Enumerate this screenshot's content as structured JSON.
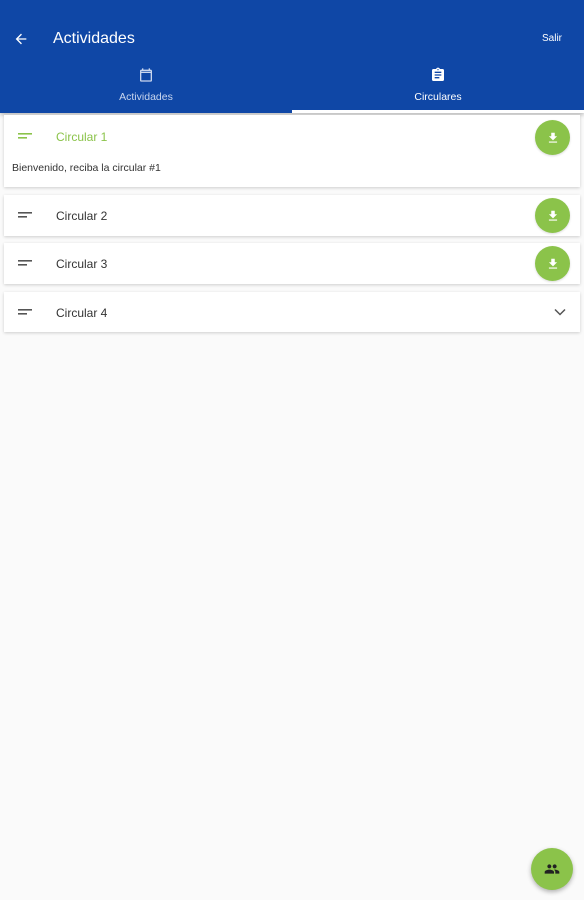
{
  "header": {
    "title": "Actividades",
    "action_label": "Salir"
  },
  "tabs": [
    {
      "label": "Actividades",
      "icon": "calendar-icon",
      "selected": false
    },
    {
      "label": "Circulares",
      "icon": "clipboard-icon",
      "selected": true
    }
  ],
  "circulars": [
    {
      "title": "Circular 1",
      "expanded": true,
      "description": "Bienvenido, reciba la circular #1",
      "action": "download-icon"
    },
    {
      "title": "Circular 2",
      "expanded": false,
      "action": "download-icon"
    },
    {
      "title": "Circular 3",
      "expanded": false,
      "action": "download-icon"
    },
    {
      "title": "Circular 4",
      "expanded": false,
      "action": "chevron-down-icon"
    }
  ],
  "fab": {
    "icon": "group-icon"
  },
  "colors": {
    "primary": "#0f47a6",
    "accent": "#8bc34a",
    "background": "#fafafa",
    "expanded_title": "#8bc34a"
  }
}
